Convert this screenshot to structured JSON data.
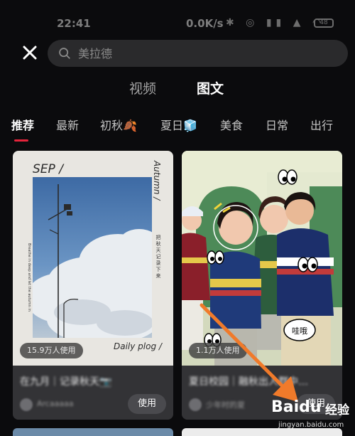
{
  "status_bar": {
    "time": "22:41",
    "network_speed": "0.0K/s",
    "battery": "48"
  },
  "search": {
    "placeholder": "美拉德"
  },
  "top_tabs": [
    {
      "label": "视频",
      "active": false
    },
    {
      "label": "图文",
      "active": true
    }
  ],
  "category_tabs": [
    {
      "label": "推荐",
      "active": true
    },
    {
      "label": "最新"
    },
    {
      "label": "初秋🍂"
    },
    {
      "label": "夏日🧊"
    },
    {
      "label": "美食"
    },
    {
      "label": "日常"
    },
    {
      "label": "出行"
    }
  ],
  "cards": [
    {
      "usage": "15.9万人使用",
      "title": "在九月｜记录秋天📷",
      "author": "Arcaaaaa",
      "use_label": "使用",
      "poster": {
        "sep": "SEP /",
        "autumn": "Autumn /",
        "daily": "Daily plog /",
        "vertical_text": "把秋天记录下来",
        "small_text": "Breathe in deep and let the autumn in"
      }
    },
    {
      "usage": "1.1万人使用",
      "title": "夏日校园｜融秋出人群中…",
      "author": "少年时的夏",
      "use_label": "使用"
    }
  ],
  "watermark": {
    "brand": "Baidu",
    "suffix": "经验",
    "url": "jingyan.baidu.com"
  },
  "colors": {
    "background": "#0b0b0d",
    "accent": "#e5243b",
    "arrow": "#f07a2a",
    "card": "#333336"
  }
}
